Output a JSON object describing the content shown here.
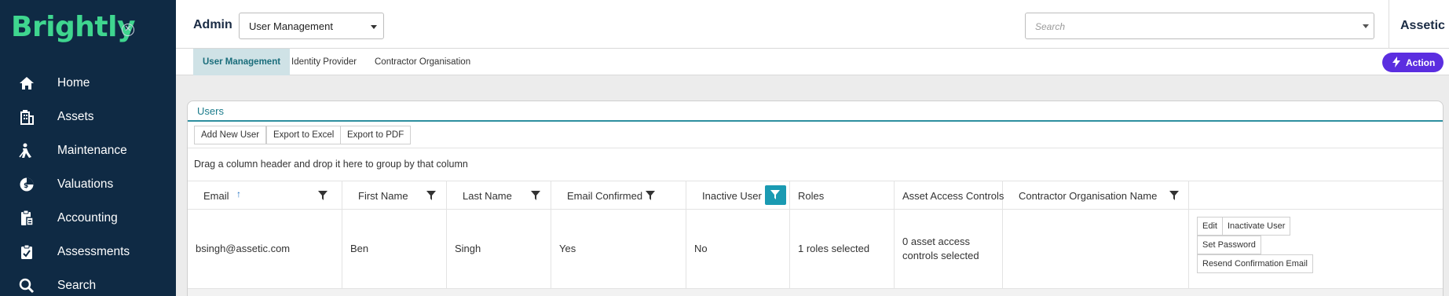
{
  "brand": {
    "logo_text": "Brightly",
    "close_glyph": "✕"
  },
  "sidebar": {
    "items": [
      {
        "label": "Home",
        "icon": "home-icon"
      },
      {
        "label": "Assets",
        "icon": "building-icon"
      },
      {
        "label": "Maintenance",
        "icon": "worker-icon"
      },
      {
        "label": "Valuations",
        "icon": "pie-dollar-icon"
      },
      {
        "label": "Accounting",
        "icon": "ledger-icon"
      },
      {
        "label": "Assessments",
        "icon": "clipboard-icon"
      },
      {
        "label": "Search",
        "icon": "search-icon"
      }
    ]
  },
  "header": {
    "title": "Admin",
    "module_select": "User Management",
    "search_placeholder": "Search",
    "tenant": "Assetic"
  },
  "subtabs": [
    "User Management",
    "Identity Provider",
    "Contractor Organisation"
  ],
  "action_button": "Action",
  "panel": {
    "tab": "Users",
    "toolbar": [
      "Add New User",
      "Export to Excel",
      "Export to PDF"
    ],
    "group_hint": "Drag a column header and drop it here to group by that column"
  },
  "columns": [
    "Email",
    "First Name",
    "Last Name",
    "Email Confirmed",
    "Inactive User",
    "Roles",
    "Asset Access Controls",
    "Contractor Organisation Name"
  ],
  "rows": [
    {
      "email": "bsingh@assetic.com",
      "first_name": "Ben",
      "last_name": "Singh",
      "email_confirmed": "Yes",
      "inactive": "No",
      "roles": "1 roles selected",
      "asset_access": "0 asset access controls selected",
      "contractor_org": "",
      "commands": [
        "Edit",
        "Inactivate User",
        "Set Password",
        "Resend Confirmation Email"
      ]
    }
  ],
  "colors": {
    "sidebar_bg": "#0f2a44",
    "brand_green": "#3fd68f",
    "accent_teal": "#1a9ab2",
    "action_purple": "#5b2ee0"
  }
}
